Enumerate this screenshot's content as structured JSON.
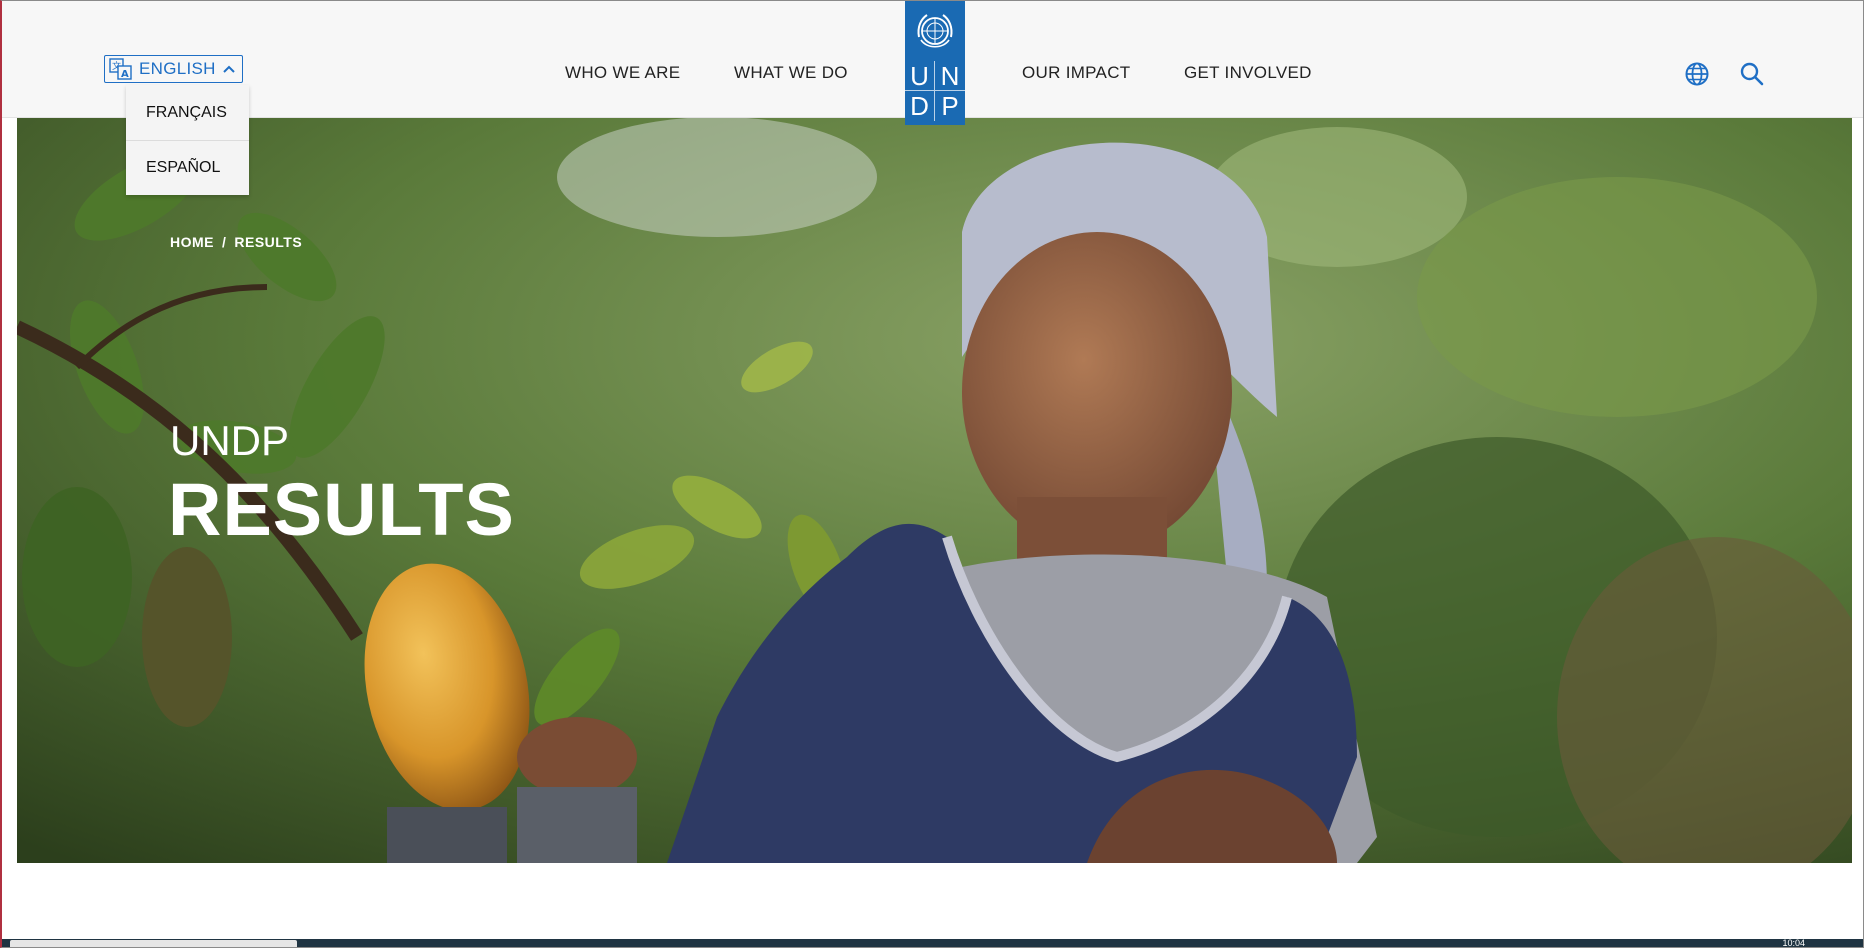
{
  "header": {
    "language": {
      "current": "ENGLISH",
      "options": [
        "FRANÇAIS",
        "ESPAÑOL"
      ],
      "icon": "translate-icon",
      "expanded": true
    },
    "nav": {
      "who_we_are": "WHO WE ARE",
      "what_we_do": "WHAT WE DO",
      "our_impact": "OUR IMPACT",
      "get_involved": "GET INVOLVED"
    },
    "logo": {
      "letters": [
        "U",
        "N",
        "D",
        "P"
      ],
      "color": "#1a6ab3",
      "icon": "un-emblem-icon"
    },
    "icons": [
      "globe-icon",
      "search-icon"
    ],
    "accent_color": "#1f6fc5"
  },
  "hero": {
    "breadcrumb": {
      "home": "HOME",
      "separator": "/",
      "current": "RESULTS"
    },
    "subtitle": "UNDP",
    "title": "RESULTS",
    "image_description_label": "hero-photo"
  },
  "taskbar": {
    "time": "10:04"
  }
}
